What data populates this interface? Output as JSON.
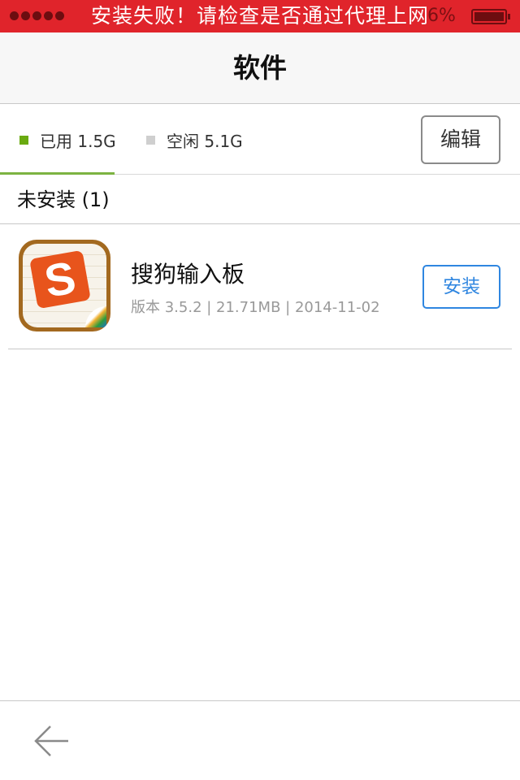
{
  "status_bar": {
    "banner_text": "安装失败！请检查是否通过代理上网",
    "battery_text": "6%",
    "battery_icon": "battery-icon",
    "signal_icon": "signal-dots-icon"
  },
  "nav": {
    "title": "软件"
  },
  "storage": {
    "used_label": "已用 1.5G",
    "free_label": "空闲 5.1G",
    "edit_label": "编辑",
    "used_color": "#6aaa10",
    "free_color": "#cfcfcf"
  },
  "section": {
    "title": "未安装 (1)"
  },
  "apps": [
    {
      "name": "搜狗输入板",
      "meta": "版本 3.5.2 | 21.71MB | 2014-11-02",
      "action_label": "安装",
      "icon_letter": "S",
      "icon": "sogou-app-icon"
    }
  ],
  "toolbar": {
    "back_icon": "back-arrow-icon"
  },
  "colors": {
    "banner": "#e0242b",
    "accent_blue": "#2f86e0"
  }
}
